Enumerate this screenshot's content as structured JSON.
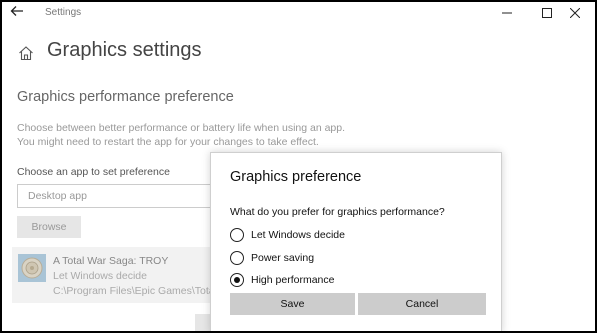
{
  "window": {
    "title": "Settings"
  },
  "page": {
    "title": "Graphics settings",
    "section_title": "Graphics performance preference",
    "description_line1": "Choose between better performance or battery life when using an app.",
    "description_line2": "You might need to restart the app for your changes to take effect.",
    "choose_label": "Choose an app to set preference",
    "dropdown_value": "Desktop app",
    "browse_label": "Browse"
  },
  "app_item": {
    "name": "A Total War Saga: TROY",
    "preference": "Let Windows decide",
    "path": "C:\\Program Files\\Epic Games\\TotalW"
  },
  "dialog": {
    "title": "Graphics preference",
    "question": "What do you prefer for graphics performance?",
    "options": [
      {
        "label": "Let Windows decide",
        "checked": false
      },
      {
        "label": "Power saving",
        "checked": false
      },
      {
        "label": "High performance",
        "checked": true
      }
    ],
    "save_label": "Save",
    "cancel_label": "Cancel"
  },
  "icons": {
    "back": "back-arrow-icon",
    "home": "home-icon",
    "minimize": "minimize-icon",
    "maximize": "maximize-icon",
    "close": "close-icon",
    "app": "troy-app-icon"
  }
}
